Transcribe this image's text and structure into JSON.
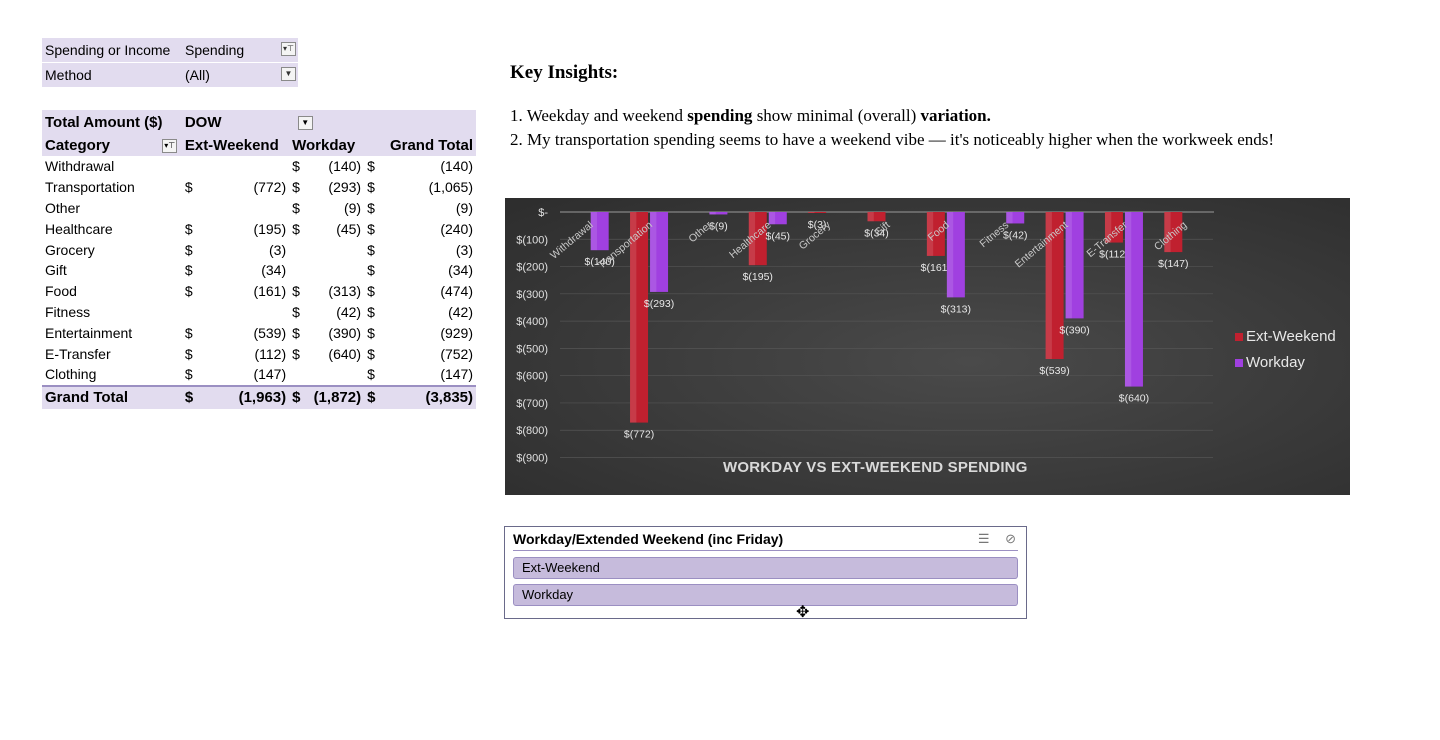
{
  "filters": [
    {
      "label": "Spending or Income",
      "value": "Spending",
      "button": "▾⊤"
    },
    {
      "label": "Method",
      "value": "(All)",
      "button": "▼"
    }
  ],
  "pivot": {
    "corner": "Total Amount ($)",
    "col_field": "DOW",
    "row_field": "Category",
    "columns": [
      "Ext-Weekend",
      "Workday",
      "Grand Total"
    ],
    "rows": [
      {
        "cat": "Withdrawal",
        "c1": [
          "",
          ""
        ],
        "c2": [
          "$",
          "(140)"
        ],
        "c3": [
          "$",
          "(140)"
        ]
      },
      {
        "cat": "Transportation",
        "c1": [
          "$",
          "(772)"
        ],
        "c2": [
          "$",
          "(293)"
        ],
        "c3": [
          "$",
          "(1,065)"
        ]
      },
      {
        "cat": "Other",
        "c1": [
          "",
          ""
        ],
        "c2": [
          "$",
          "(9)"
        ],
        "c3": [
          "$",
          "(9)"
        ]
      },
      {
        "cat": "Healthcare",
        "c1": [
          "$",
          "(195)"
        ],
        "c2": [
          "$",
          "(45)"
        ],
        "c3": [
          "$",
          "(240)"
        ]
      },
      {
        "cat": "Grocery",
        "c1": [
          "$",
          "(3)"
        ],
        "c2": [
          "",
          ""
        ],
        "c3": [
          "$",
          "(3)"
        ]
      },
      {
        "cat": "Gift",
        "c1": [
          "$",
          "(34)"
        ],
        "c2": [
          "",
          ""
        ],
        "c3": [
          "$",
          "(34)"
        ]
      },
      {
        "cat": "Food",
        "c1": [
          "$",
          "(161)"
        ],
        "c2": [
          "$",
          "(313)"
        ],
        "c3": [
          "$",
          "(474)"
        ]
      },
      {
        "cat": "Fitness",
        "c1": [
          "",
          ""
        ],
        "c2": [
          "$",
          "(42)"
        ],
        "c3": [
          "$",
          "(42)"
        ]
      },
      {
        "cat": "Entertainment",
        "c1": [
          "$",
          "(539)"
        ],
        "c2": [
          "$",
          "(390)"
        ],
        "c3": [
          "$",
          "(929)"
        ]
      },
      {
        "cat": "E-Transfer",
        "c1": [
          "$",
          "(112)"
        ],
        "c2": [
          "$",
          "(640)"
        ],
        "c3": [
          "$",
          "(752)"
        ]
      },
      {
        "cat": "Clothing",
        "c1": [
          "$",
          "(147)"
        ],
        "c2": [
          "",
          ""
        ],
        "c3": [
          "$",
          "(147)"
        ]
      }
    ],
    "total": {
      "cat": "Grand Total",
      "c1": [
        "$",
        "(1,963)"
      ],
      "c2": [
        "$",
        "(1,872)"
      ],
      "c3": [
        "$",
        "(3,835)"
      ]
    }
  },
  "insights": {
    "heading": "Key Insights:",
    "line1": {
      "a": "1. Weekday and weekend ",
      "b": "spending",
      "c": " show minimal (overall) ",
      "d": "variation."
    },
    "line2": "2. My transportation spending seems to have a weekend vibe — it's noticeably higher when the workweek ends!"
  },
  "chart_data": {
    "type": "bar",
    "title": "WORKDAY VS EXT-WEEKEND SPENDING",
    "categories": [
      "Withdrawal",
      "Transportation",
      "Other",
      "Healthcare",
      "Grocery",
      "Gift",
      "Food",
      "Fitness",
      "Entertainment",
      "E-Transfer",
      "Clothing"
    ],
    "series": [
      {
        "name": "Ext-Weekend",
        "color": "#c0202f",
        "values": [
          null,
          -772,
          null,
          -195,
          -3,
          -34,
          -161,
          null,
          -539,
          -112,
          -147
        ]
      },
      {
        "name": "Workday",
        "color": "#a040e0",
        "values": [
          -140,
          -293,
          -9,
          -45,
          null,
          null,
          -313,
          -42,
          -390,
          -640,
          null
        ]
      }
    ],
    "y_ticks": [
      "$-",
      "$(100)",
      "$(200)",
      "$(300)",
      "$(400)",
      "$(500)",
      "$(600)",
      "$(700)",
      "$(800)",
      "$(900)"
    ],
    "ylim": [
      -900,
      0
    ],
    "grid": true,
    "legend": "right"
  },
  "slicer": {
    "title": "Workday/Extended Weekend (inc Friday)",
    "items": [
      "Ext-Weekend",
      "Workday"
    ],
    "icon_multiselect": "☰",
    "icon_clear": "⊘"
  }
}
